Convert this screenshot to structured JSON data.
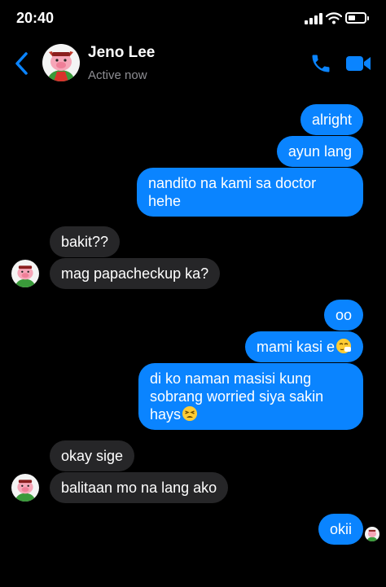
{
  "status_bar": {
    "time": "20:40",
    "battery_level": 0.35
  },
  "header": {
    "name": "Jeno Lee",
    "status": "Active now"
  },
  "messages": {
    "m1": "alright",
    "m2": "ayun lang",
    "m3": "nandito na kami sa doctor hehe",
    "m4": "bakit??",
    "m5": "mag papacheckup ka?",
    "m6": "oo",
    "m7": "mami kasi e",
    "m8": "di ko naman masisi kung sobrang worried siya sakin hays",
    "m9": "okay sige",
    "m10": "balitaan mo na lang ako",
    "m11": "okii"
  },
  "icons": {
    "back": "chevron-left-icon",
    "call": "phone-icon",
    "video": "video-camera-icon",
    "emoji_sneeze": "sneezing-face-emoji",
    "emoji_tired": "tired-face-emoji"
  },
  "colors": {
    "accent": "#0a84ff",
    "incoming_bubble": "#262628",
    "background": "#000000"
  }
}
